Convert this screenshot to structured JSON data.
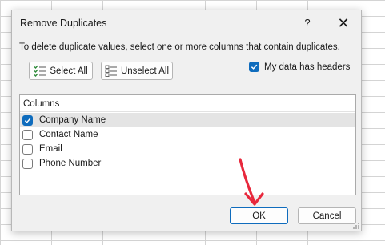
{
  "dialog": {
    "title": "Remove Duplicates",
    "help_glyph": "?",
    "close_glyph": "✕",
    "instructions": "To delete duplicate values, select one or more columns that contain duplicates.",
    "select_all_label": "Select All",
    "unselect_all_label": "Unselect All",
    "headers_checkbox": {
      "label": "My data has headers",
      "checked": true
    },
    "columns_header": "Columns",
    "columns": [
      {
        "label": "Company Name",
        "checked": true,
        "selected": true
      },
      {
        "label": "Contact Name",
        "checked": false,
        "selected": false
      },
      {
        "label": "Email",
        "checked": false,
        "selected": false
      },
      {
        "label": "Phone Number",
        "checked": false,
        "selected": false
      }
    ],
    "ok_label": "OK",
    "cancel_label": "Cancel"
  },
  "colors": {
    "accent": "#0f6cbd",
    "annotation_arrow": "#e8283c",
    "dialog_background": "#f0f0f0",
    "selected_row": "#e4e4e4"
  }
}
